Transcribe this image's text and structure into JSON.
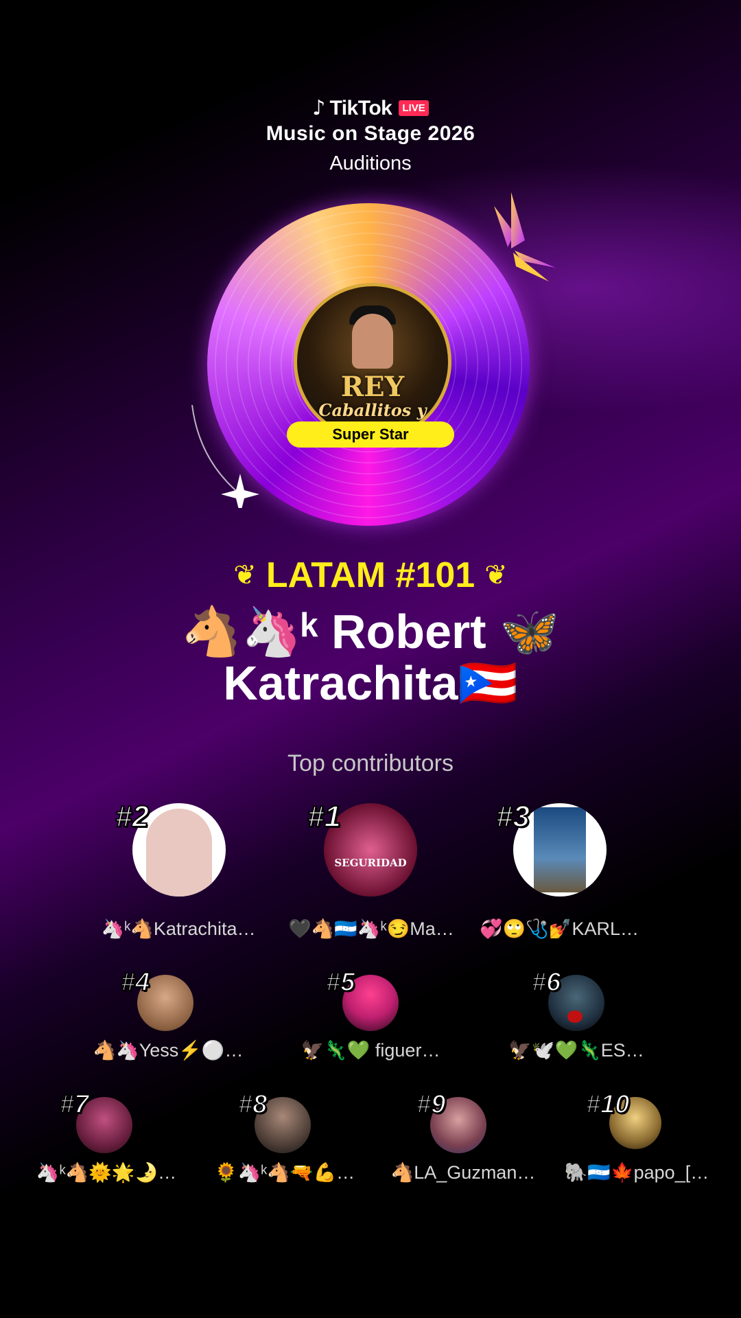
{
  "header": {
    "brand_name": "TikTok",
    "live_badge": "LIVE",
    "event_title": "Music on Stage 2026",
    "event_subtitle": "Auditions"
  },
  "artist_card": {
    "cover_text_main": "REY",
    "cover_text_sub": "Caballitos y Unicornios",
    "tier_badge": "Super Star"
  },
  "ranking": {
    "label": "LATAM #101",
    "name_line1": "🐴🦄ᵏ Robert 🦋",
    "name_line2": "Katrachita🇵🇷"
  },
  "contributors": {
    "title": "Top contributors",
    "top3": [
      {
        "rank": "#2",
        "name": "🦄ᵏ🐴Katrachita…",
        "color": "#e8c8c0"
      },
      {
        "rank": "#1",
        "name": "🖤🐴🇭🇳🦄ᵏ😏Ma…",
        "color": "#b04070"
      },
      {
        "rank": "#3",
        "name": "💞🙄🩺💅KARL…",
        "color": "#5a8ab8"
      }
    ],
    "row2": [
      {
        "rank": "#4",
        "name": "🐴🦄Yess⚡⚪…",
        "color": "#8a6040"
      },
      {
        "rank": "#5",
        "name": "🦅🦎💚 figuer…",
        "color": "#c02070"
      },
      {
        "rank": "#6",
        "name": "🦅🕊️💚🦎ES…",
        "color": "#203040"
      }
    ],
    "row3": [
      {
        "rank": "#7",
        "name": "🦄ᵏ🐴🌞🌟🌛…",
        "color": "#6a2040"
      },
      {
        "rank": "#8",
        "name": "🌻🦄ᵏ🐴🔫💪…",
        "color": "#504038"
      },
      {
        "rank": "#9",
        "name": "🐴LA_Guzman…",
        "color": "#7a4050"
      },
      {
        "rank": "#10",
        "name": "🐘🇭🇳🍁papo_[…",
        "color": "#8a6a30"
      }
    ]
  },
  "colors": {
    "accent_yellow": "#ffee1a",
    "live_red": "#ff2a55",
    "vinyl_purple": "#a012e8"
  }
}
